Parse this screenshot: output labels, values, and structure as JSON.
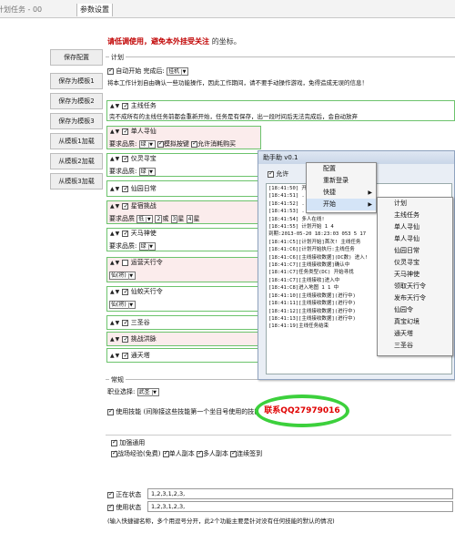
{
  "tabs": [
    {
      "label": "计划任务 - 00",
      "active": false
    },
    {
      "label": "参数设置",
      "active": true
    }
  ],
  "sidebar": [
    {
      "label": "保存配置"
    },
    {
      "label": "保存为模板1"
    },
    {
      "label": "保存为模板2"
    },
    {
      "label": "保存为模板3"
    },
    {
      "label": "从模板1加载"
    },
    {
      "label": "从模板2加载"
    },
    {
      "label": "从模板3加载"
    }
  ],
  "warning": {
    "text": "请低调使用，避免本外挂受关注",
    "suffix": "的坐标。"
  },
  "plan": {
    "header": "计划",
    "auto_start_label": "自动开始",
    "after_label": "完成后",
    "after_value": "挂机",
    "note": "将本工作计划自由确认一些功能操作，因此工作期间，请不要手动操作游戏，免得造成无误的信息！"
  },
  "tasks": [
    {
      "name": "主线任务",
      "note": "完不成所有的主线任务前都会重新开始，任务是有保存，出一段时间后无法完成后，会自动放弃"
    },
    {
      "name": "单人寻仙",
      "req_label": "要求品质",
      "req_value": "绿",
      "opt1": "模拟按键",
      "opt2": "允许消耗购买"
    },
    {
      "name": "仪灵寻宝",
      "req_label": "要求品质",
      "req_value": "绿"
    },
    {
      "name": "仙园日常"
    },
    {
      "name": "星宿挑战",
      "req_label": "要求品质",
      "req_value": "低",
      "lv_label": "或",
      "lv1": "2",
      "lv2": "3",
      "lv3": "4",
      "unit": "星"
    },
    {
      "name": "天马神使",
      "req_label": "要求品质",
      "req_value": "绿"
    },
    {
      "name": "运营天行令",
      "sub_value": "仙(将)"
    },
    {
      "name": "仙蛟天行令",
      "sub_value": "仙(将)"
    },
    {
      "name": "三圣谷"
    },
    {
      "name": "挑战洪脉"
    },
    {
      "name": "通天塔"
    }
  ],
  "misc": {
    "header": "常规",
    "status_label": "职业选择",
    "status_value": "武圣",
    "use_skill_label": "使用技能",
    "use_skill_note": "(间隙接这些技能第一个坐目号使用的技能)",
    "contact": "联系QQ27979016",
    "combat_header": "加强通用",
    "opt_a": "战场经验(免费)",
    "opt_b": "单人副本",
    "opt_c": "多人副本",
    "opt_d": "连续签到"
  },
  "bottom": {
    "buff_label": "正在状态",
    "buff_value": "1,2,3,1,2,3,",
    "skill_label": "使用状态",
    "skill_value": "1,2,3,1,2,3,",
    "note": "(输入快捷键名称，多个用逗号分开，此2个功能主要是针对没有任何技能的默认的情况)"
  },
  "popup": {
    "title": "助手助 v0.1",
    "auto_label": "允许",
    "op_button": "操作",
    "log": [
      "[18:41:50] 开始登录",
      "[18:41:51] ...",
      "[18:41:52] ...",
      "[18:41:53] ...",
      "[18:41:54] 多人在线!",
      "[18:41:55] 计划开始 1 4",
      "到期:2013-05-20 18:23:03 053 5 17",
      "[18:41:C5][计划开始]首次! 主线任务",
      "[18:41:C6][计划开始执行:主线任务",
      "[18:41:C6][主线接收数据](DC数) 进入!",
      "[18:41:C7][主线接收数据]确认中",
      "[18:41:C7]任务类型(DC) 开始寻找",
      "[18:41:C7][主线接收]进入中",
      "[18:41:C8]进入地图 1 1 中",
      "[18:41:10][主线接收数据](进行中)",
      "[18:41:11][主线接收数据](进行中)",
      "[18:41:12][主线接收数据](进行中)",
      "[18:41:13][主线接收数据](进行中)",
      "[18:41:19]主线任务结束"
    ]
  },
  "menu1": [
    "配置",
    "重新登录",
    "快捷",
    "开始"
  ],
  "menu2": [
    "计划",
    "主线任务",
    "单人寻仙",
    "单人寻仙",
    "仙园日常",
    "仪灵寻宝",
    "天马神使",
    "领取天行令",
    "发布天行令",
    "仙园令",
    "真宝幻境",
    "通天塔",
    "三圣谷"
  ]
}
